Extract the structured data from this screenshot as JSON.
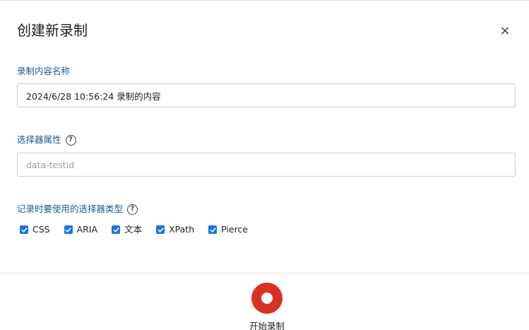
{
  "dialog": {
    "title": "创建新录制",
    "close_label": "×"
  },
  "recording_name": {
    "label": "录制内容名称",
    "value": "2024/6/28 10:56:24 录制的内容"
  },
  "selector_attribute": {
    "label": "选择器属性",
    "help_icon": "?",
    "value": "",
    "placeholder": "data-testid"
  },
  "selector_types": {
    "label": "记录时要使用的选择器类型",
    "help_icon": "?",
    "options": [
      {
        "label": "CSS",
        "checked": true
      },
      {
        "label": "ARIA",
        "checked": true
      },
      {
        "label": "文本",
        "checked": true
      },
      {
        "label": "XPath",
        "checked": true
      },
      {
        "label": "Pierce",
        "checked": true
      }
    ]
  },
  "start_button": {
    "label": "开始录制",
    "icon": "record-icon",
    "color": "#d93025"
  },
  "colors": {
    "accent": "#1a73e8",
    "label_text": "#1a5a96"
  }
}
